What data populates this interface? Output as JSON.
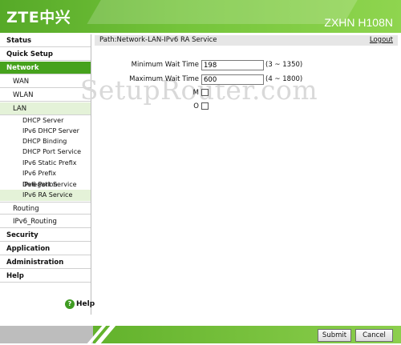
{
  "header": {
    "logo": "ZTE中兴",
    "model": "ZXHN H108N"
  },
  "sidebar": {
    "status": "Status",
    "quick_setup": "Quick Setup",
    "network": "Network",
    "wan": "WAN",
    "wlan": "WLAN",
    "lan": "LAN",
    "lan_items": [
      "DHCP Server",
      "IPv6 DHCP Server",
      "DHCP Binding",
      "DHCP Port Service",
      "IPv6 Static Prefix",
      "IPv6 Prefix Delegation",
      "IPv6 Port Service",
      "IPv6 RA Service"
    ],
    "routing": "Routing",
    "ipv6_routing": "IPv6_Routing",
    "security": "Security",
    "application": "Application",
    "administration": "Administration",
    "help": "Help",
    "help_link": "Help",
    "help_icon_glyph": "?"
  },
  "content": {
    "path": "Path:Network-LAN-IPv6 RA Service",
    "logout": "Logout",
    "watermark": "SetupRouter.com",
    "min_label": "Minimum Wait Time",
    "min_value": "198",
    "min_range": "(3 ~ 1350)",
    "max_label": "Maximum Wait Time",
    "max_value": "600",
    "max_range": "(4 ~ 1800)",
    "m_label": "M",
    "o_label": "O"
  },
  "footer": {
    "submit": "Submit",
    "cancel": "Cancel"
  },
  "colors": {
    "brand_green": "#46a21d",
    "active_light": "#e4f2d8",
    "path_bar": "#e6e6e6"
  }
}
